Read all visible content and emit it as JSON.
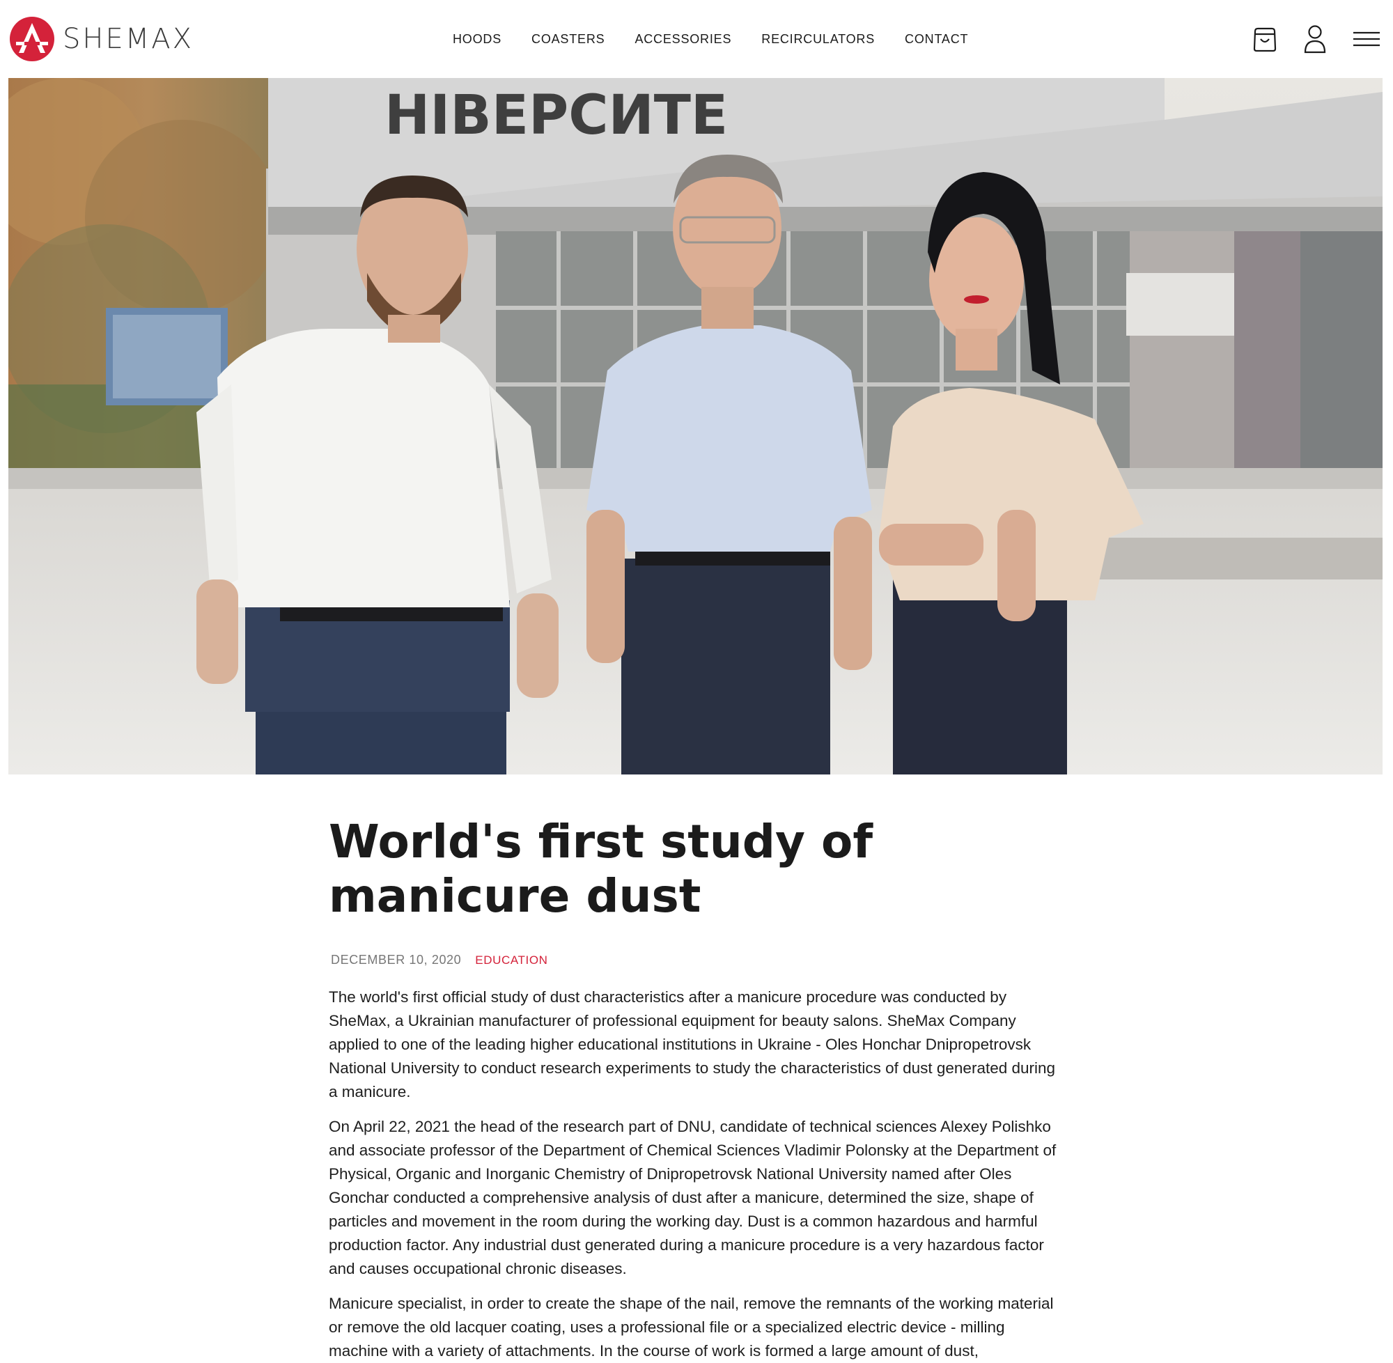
{
  "header": {
    "brand": "SHEMAX",
    "nav": [
      {
        "label": "HOODS"
      },
      {
        "label": "COASTERS"
      },
      {
        "label": "ACCESSORIES"
      },
      {
        "label": "RECIRCULATORS"
      },
      {
        "label": "CONTACT"
      }
    ],
    "icons": [
      "cart-icon",
      "user-icon",
      "menu-icon"
    ]
  },
  "hero": {
    "sign_text": "НІВЕРСИТЕ"
  },
  "article": {
    "title": "World's first study of manicure dust",
    "date": "DECEMBER 10, 2020",
    "category": "EDUCATION",
    "paragraphs": [
      "The world's first official study of dust characteristics after a manicure procedure was conducted by SheMax, a Ukrainian manufacturer of professional equipment for beauty salons. SheMax Company applied to one of the leading higher educational institutions in Ukraine - Oles Honchar Dnipropetrovsk National University to conduct research experiments to study the characteristics of dust generated during a manicure.",
      "On April 22, 2021 the head of the research part of DNU, candidate of technical sciences Alexey Polishko and associate professor of the Department of Chemical Sciences Vladimir Polonsky at the Department of Physical, Organic and Inorganic Chemistry of Dnipropetrovsk National University named after Oles Gonchar conducted a comprehensive analysis of dust after a manicure, determined the size, shape of particles and movement in the room during the working day. Dust is a common hazardous and harmful production factor. Any industrial dust generated during a manicure procedure is a very hazardous factor and causes occupational chronic diseases.",
      "Manicure specialist, in order to create the shape of the nail, remove the remnants of the working material or remove the old lacquer coating, uses a professional file or a specialized electric device - milling machine with a variety of attachments. In the course of work is formed a large amount of dust,"
    ]
  },
  "colors": {
    "brand_red": "#d4223a",
    "text": "#1b1b1b",
    "meta_gray": "#777777"
  }
}
